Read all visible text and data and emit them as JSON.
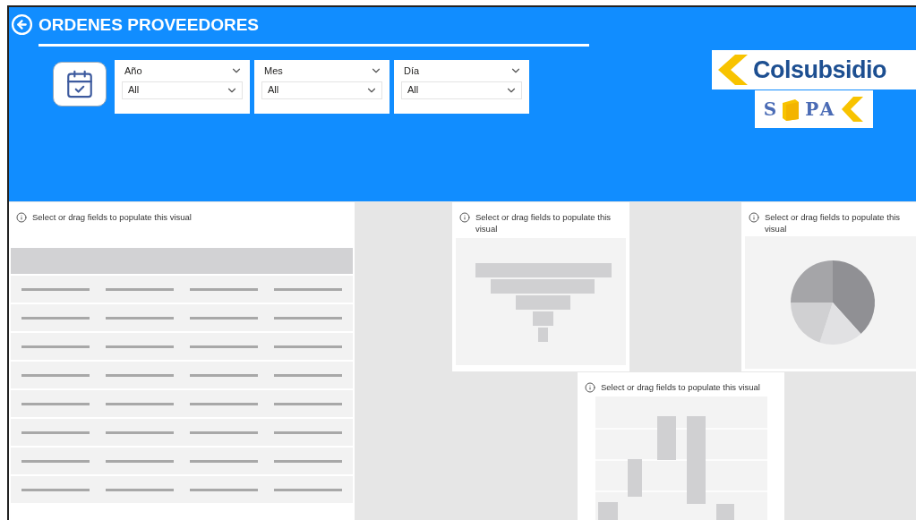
{
  "header": {
    "title": "ORDENES PROVEEDORES"
  },
  "slicers": [
    {
      "label": "Año",
      "value": "All"
    },
    {
      "label": "Mes",
      "value": "All"
    },
    {
      "label": "Día",
      "value": "All"
    }
  ],
  "logos": {
    "colsubsidio": "Colsubsidio",
    "supa_left": "S",
    "supa_right": "PA"
  },
  "visuals": [
    {
      "kind": "table",
      "message": "Select or drag fields to populate this visual"
    },
    {
      "kind": "funnel",
      "message": "Select or drag fields to populate this visual"
    },
    {
      "kind": "pie",
      "message": "Select or drag fields to populate this visual"
    },
    {
      "kind": "waterfall",
      "message": "Select or drag fields to populate this visual"
    }
  ]
}
